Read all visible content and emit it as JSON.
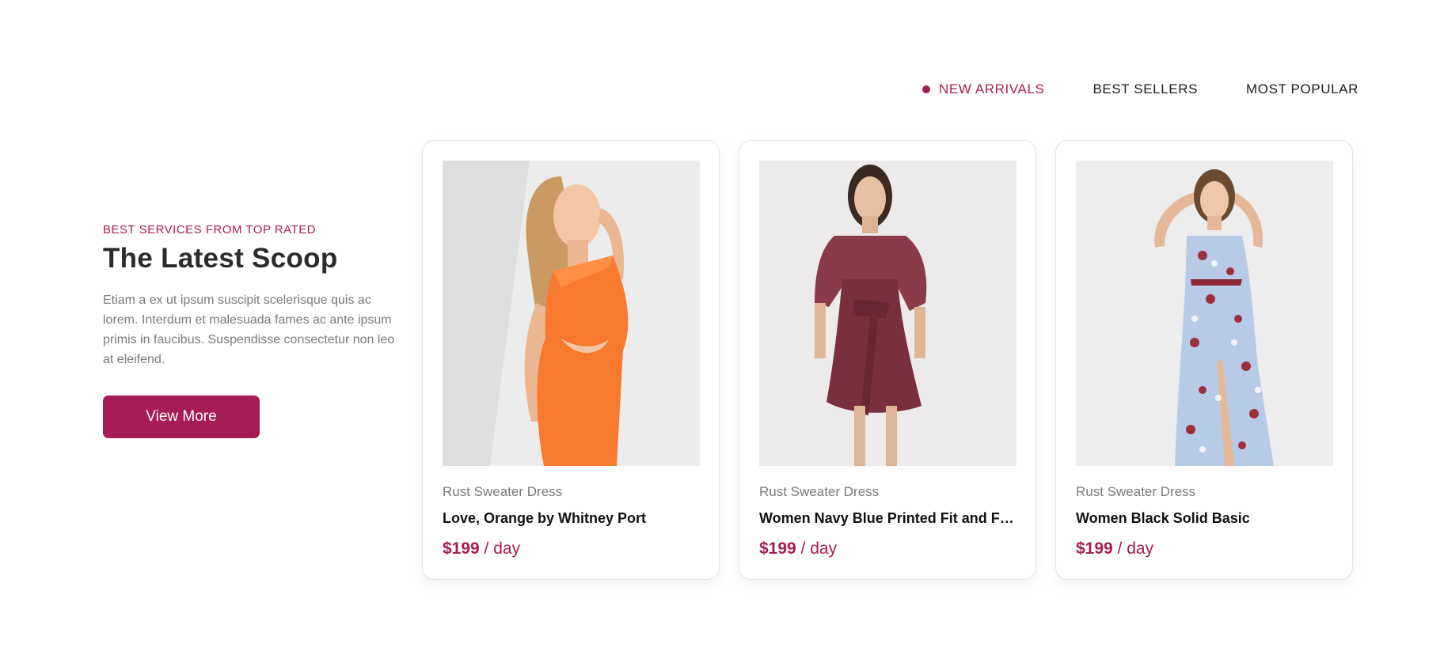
{
  "colors": {
    "accent": "#a61c56",
    "heading": "#2b2b2b",
    "muted": "#7a7a7a"
  },
  "tabs": [
    {
      "label": "NEW ARRIVALS",
      "active": true
    },
    {
      "label": "BEST SELLERS",
      "active": false
    },
    {
      "label": "MOST POPULAR",
      "active": false
    }
  ],
  "intro": {
    "eyebrow": "BEST SERVICES FROM TOP RATED",
    "heading": "The Latest Scoop",
    "description": "Etiam a ex ut ipsum suscipit scelerisque quis ac lorem. Interdum et malesuada fames ac ante ipsum primis in faucibus. Suspendisse consectetur non leo at eleifend.",
    "button_label": "View More"
  },
  "products": [
    {
      "subtitle": "Rust Sweater Dress",
      "name": "Love, Orange by Whitney Port",
      "price": "$199",
      "unit": " / day",
      "image": "orange-dress-photo"
    },
    {
      "subtitle": "Rust Sweater Dress",
      "name": "Women Navy Blue Printed Fit and Flare Dress",
      "price": "$199",
      "unit": " / day",
      "image": "burgundy-dress-photo"
    },
    {
      "subtitle": "Rust Sweater Dress",
      "name": "Women Black Solid Basic",
      "price": "$199",
      "unit": " / day",
      "image": "floral-maxi-dress-photo"
    }
  ]
}
